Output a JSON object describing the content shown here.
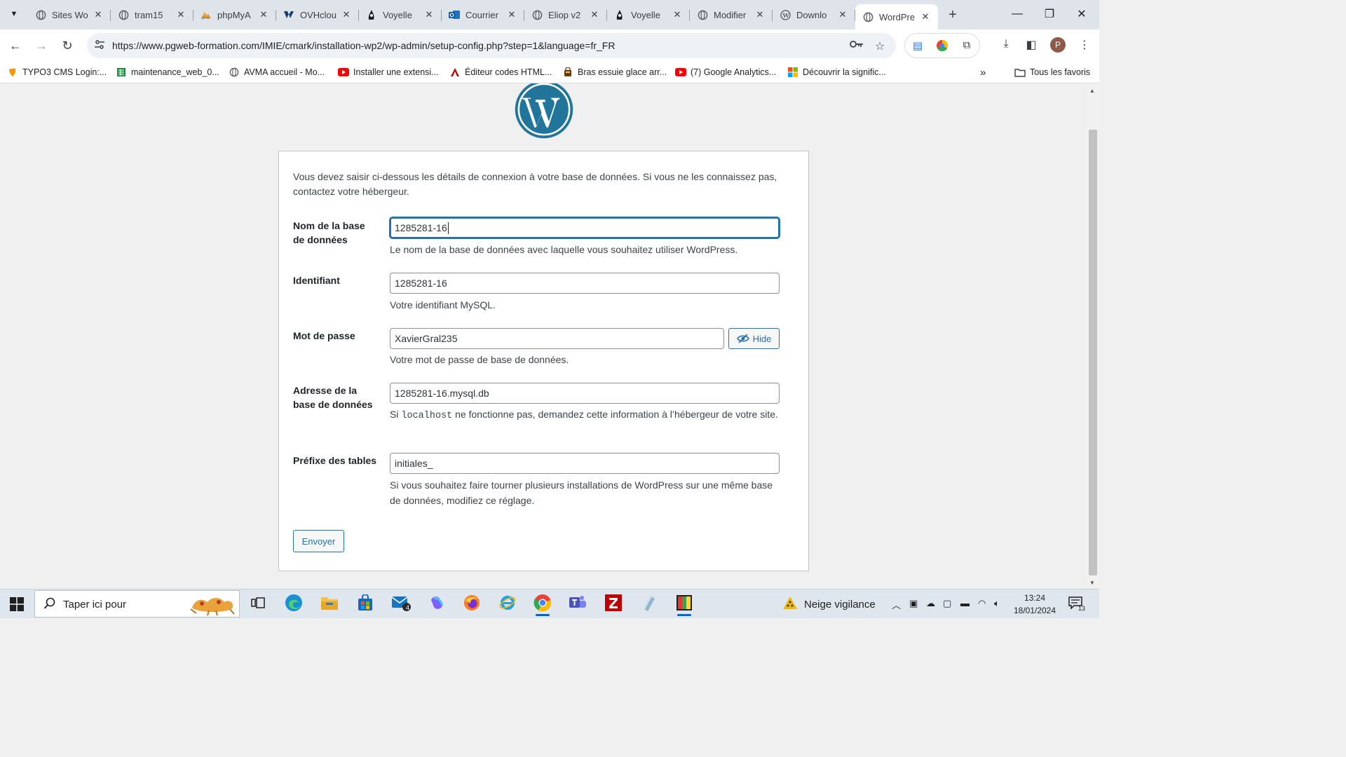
{
  "browser": {
    "tabs": [
      {
        "title": "Sites Wo",
        "icon": "globe-icon",
        "active": false
      },
      {
        "title": "tram15",
        "icon": "globe-icon",
        "active": false
      },
      {
        "title": "phpMyA",
        "icon": "phpmyadmin-icon",
        "active": false
      },
      {
        "title": "OVHclou",
        "icon": "ovh-icon",
        "active": false
      },
      {
        "title": "Voyelle",
        "icon": "voyelle-icon",
        "active": false
      },
      {
        "title": "Courrier",
        "icon": "outlook-icon",
        "active": false
      },
      {
        "title": "Eliop v2",
        "icon": "globe-icon",
        "active": false
      },
      {
        "title": "Voyelle",
        "icon": "voyelle-icon",
        "active": false
      },
      {
        "title": "Modifier",
        "icon": "globe-icon",
        "active": false
      },
      {
        "title": "Downlo",
        "icon": "wordpress-icon",
        "active": false
      },
      {
        "title": "WordPre",
        "icon": "globe-icon",
        "active": true
      }
    ],
    "url": "https://www.pgweb-formation.com/IMIE/cmark/installation-wp2/wp-admin/setup-config.php?step=1&language=fr_FR",
    "avatar_letter": "P",
    "bookmarks": [
      {
        "label": "TYPO3 CMS Login:...",
        "icon": "typo3-icon"
      },
      {
        "label": "maintenance_web_0...",
        "icon": "sheets-icon"
      },
      {
        "label": "AVMA accueil - Mo...",
        "icon": "globe-icon"
      },
      {
        "label": "Installer une extensi...",
        "icon": "youtube-icon"
      },
      {
        "label": "Éditeur codes HTML...",
        "icon": "acrobat-icon"
      },
      {
        "label": "Bras essuie glace arr...",
        "icon": "shop-icon"
      },
      {
        "label": "(7) Google Analytics...",
        "icon": "youtube-icon"
      },
      {
        "label": "Découvrir la signific...",
        "icon": "microsoft-icon"
      }
    ],
    "all_bookmarks": "Tous les favoris"
  },
  "form": {
    "intro": "Vous devez saisir ci-dessous les détails de connexion à votre base de données. Si vous ne les connaissez pas, contactez votre hébergeur.",
    "dbname": {
      "label": "Nom de la base de données",
      "value": "1285281-16",
      "desc": "Le nom de la base de données avec laquelle vous souhaitez utiliser WordPress."
    },
    "username": {
      "label": "Identifiant",
      "value": "1285281-16",
      "desc": "Votre identifiant MySQL."
    },
    "password": {
      "label": "Mot de passe",
      "value": "XavierGral235",
      "hide_label": "Hide",
      "desc": "Votre mot de passe de base de données."
    },
    "dbhost": {
      "label": "Adresse de la base de données",
      "value": "1285281-16.mysql.db",
      "desc_before": "Si ",
      "desc_code": "localhost",
      "desc_after": " ne fonctionne pas, demandez cette information à l’hébergeur de votre site."
    },
    "prefix": {
      "label": "Préfixe des tables",
      "value": "initiales_",
      "desc": "Si vous souhaitez faire tourner plusieurs installations de WordPress sur une même base de données, modifiez ce réglage."
    },
    "submit_label": "Envoyer"
  },
  "taskbar": {
    "search_placeholder": "Taper ici pour",
    "mail_badge": "4",
    "weather": "Neige vigilance",
    "time": "13:24",
    "date": "18/01/2024",
    "notifications": "13"
  },
  "colors": {
    "wp_blue": "#2271b1",
    "wp_logo": "#21759b",
    "page_bg": "#f0f0f1"
  }
}
